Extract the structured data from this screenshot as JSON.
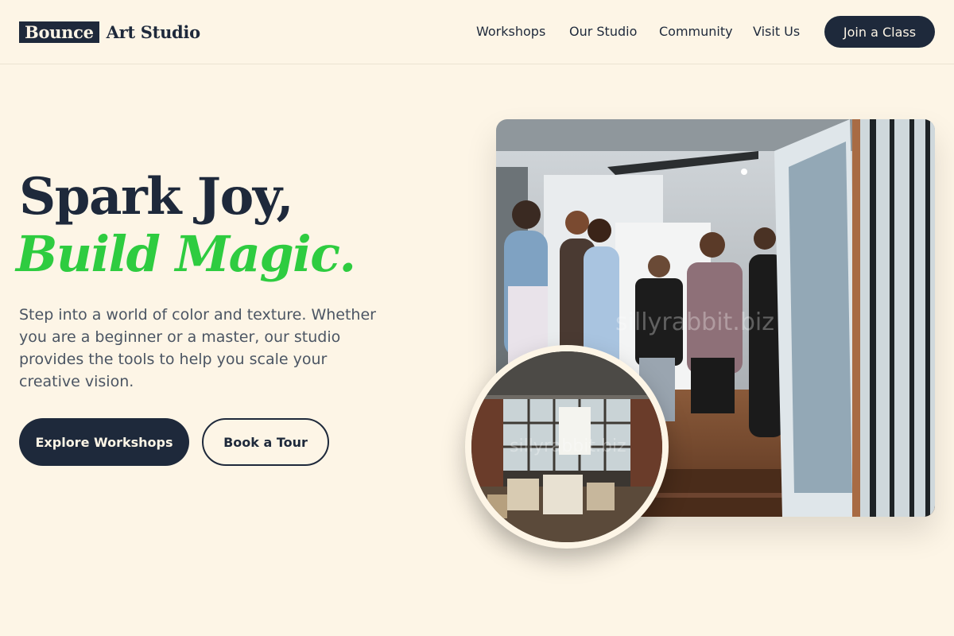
{
  "header": {
    "logo_box": "Bounce",
    "logo_text": "Art Studio",
    "nav": [
      "Workshops",
      "Our Studio",
      "Community",
      "Visit Us"
    ],
    "cta": "Join a Class"
  },
  "hero": {
    "headline_line1": "Spark Joy,",
    "headline_line2": "Build Magic.",
    "description": "Step into a world of color and texture. Whether you are a beginner or a master, our studio provides the tools to help you scale your creative vision.",
    "primary_button": "Explore Workshops",
    "secondary_button": "Book a Tour"
  },
  "images": {
    "main_watermark": "sillyrabbit.biz",
    "circle_watermark": "sillyrabbit.biz"
  },
  "colors": {
    "background": "#fdf5e6",
    "navy": "#1e293b",
    "accent_green": "#2ecc40"
  }
}
